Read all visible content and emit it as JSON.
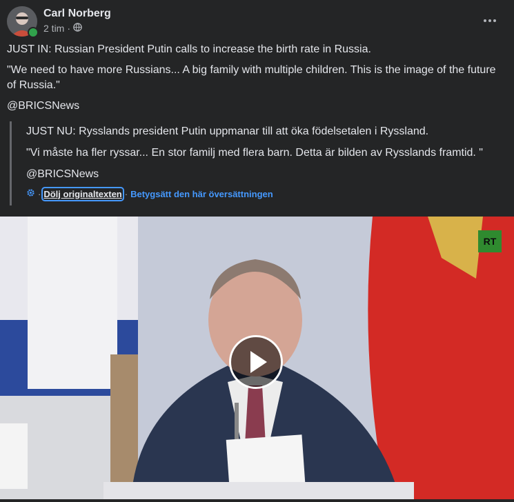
{
  "post": {
    "author": "Carl Norberg",
    "timestamp": "2 tim",
    "separator": "·",
    "audience_icon": "globe-icon",
    "more_icon": "more-horizontal-icon",
    "text_lines": [
      "JUST IN: Russian President Putin calls to increase the birth rate in Russia.",
      "\"We need to have more Russians... A big family with multiple children. This is the image of the future of Russia.\"",
      "@BRICSNews"
    ]
  },
  "translation": {
    "lines": [
      "JUST NU: Rysslands president Putin uppmanar till att öka födelsetalen i Ryssland.",
      "\"Vi måste ha fler ryssar... En stor familj med flera barn. Detta är bilden av Rysslands framtid. \"",
      "@BRICSNews"
    ],
    "settings_icon": "gear-icon",
    "hide_original": "Dölj originaltexten",
    "rate_translation": "Betygsätt den här översättningen",
    "dot": "·"
  },
  "video": {
    "play_icon": "play-icon",
    "watermark": "RT"
  },
  "colors": {
    "background": "#242526",
    "text": "#e4e6eb",
    "secondary": "#b0b3b8",
    "link": "#4599ff",
    "online": "#31a24c"
  }
}
